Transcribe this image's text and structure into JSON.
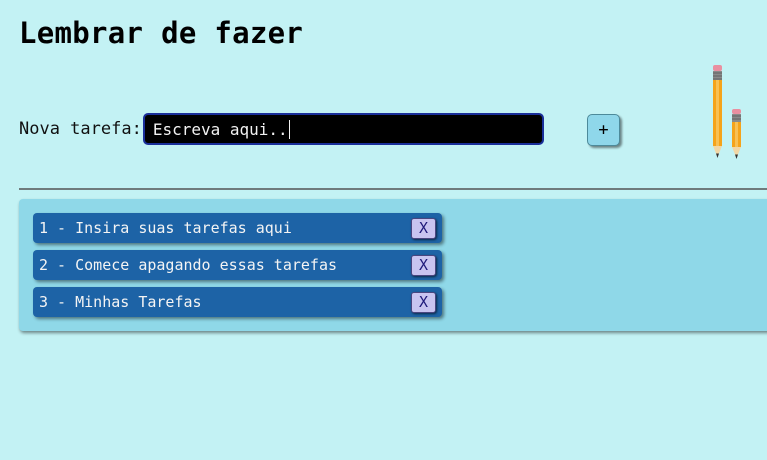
{
  "header": {
    "title": "Lembrar de fazer"
  },
  "form": {
    "label": "Nova tarefa:",
    "input_value": "Escreva aqui..",
    "add_label": "+"
  },
  "decoration": {
    "icon": "pencils-icon"
  },
  "tasks": [
    {
      "text": "1 - Insira suas tarefas aqui",
      "delete_label": "X"
    },
    {
      "text": "2 - Comece apagando essas tarefas",
      "delete_label": "X"
    },
    {
      "text": "3 - Minhas Tarefas",
      "delete_label": "X"
    }
  ],
  "colors": {
    "background": "#c3f2f4",
    "panel": "#8fd8e8",
    "task_item": "#1d63a6",
    "input_bg": "#000000",
    "delete_button": "#c8c4f0"
  }
}
